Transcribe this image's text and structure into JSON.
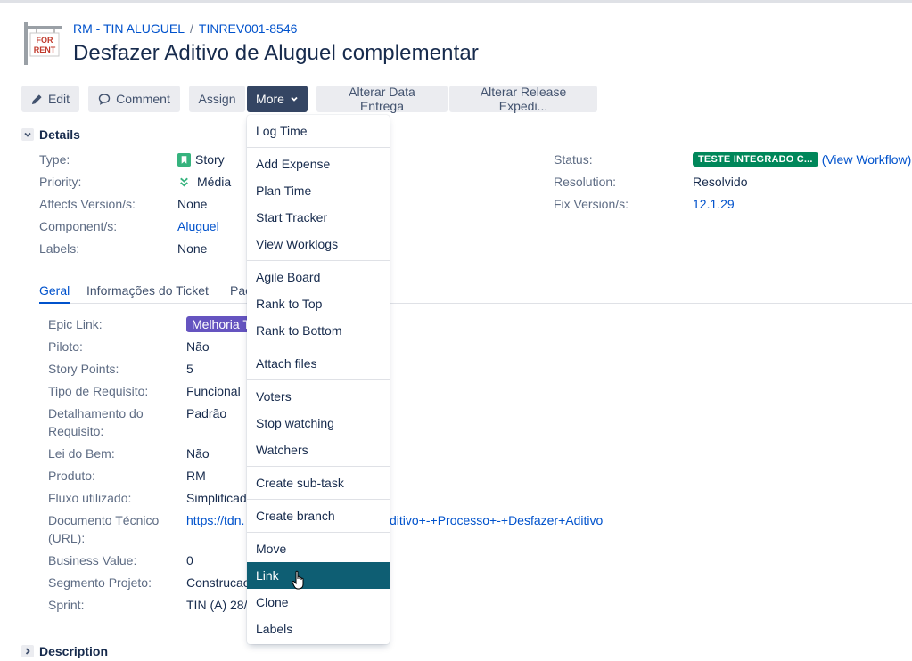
{
  "breadcrumb": {
    "project": "RM - TIN ALUGUEL",
    "separator": "/",
    "issue_key": "TINREV001-8546"
  },
  "title": "Desfazer Aditivo de Aluguel complementar",
  "project_avatar": {
    "icon": "for-rent-sign-icon",
    "text_line1": "FOR",
    "text_line2": "RENT"
  },
  "toolbar": {
    "edit": "Edit",
    "comment": "Comment",
    "assign": "Assign",
    "more": "More",
    "alterar_data": "Alterar Data Entrega",
    "alterar_release": "Alterar Release Expedi..."
  },
  "details": {
    "heading": "Details",
    "left": [
      {
        "label": "Type:",
        "value": "Story",
        "icon": "story-icon"
      },
      {
        "label": "Priority:",
        "value": "Média",
        "icon": "priority-medium-icon"
      },
      {
        "label": "Affects Version/s:",
        "value": "None"
      },
      {
        "label": "Component/s:",
        "value": "Aluguel"
      },
      {
        "label": "Labels:",
        "value": "None"
      }
    ],
    "right": {
      "status_label": "Status:",
      "status_value": "TESTE INTEGRADO C...",
      "view_workflow": "(View Workflow)",
      "resolution_label": "Resolution:",
      "resolution_value": "Resolvido",
      "fix_label": "Fix Version/s:",
      "fix_value": "12.1.29"
    }
  },
  "tabs": {
    "geral": "Geral",
    "informacoes": "Informações do Ticket",
    "pac": "Pac"
  },
  "geral_fields": [
    {
      "label": "Epic Link:",
      "value": "Melhoria T"
    },
    {
      "label": "Piloto:",
      "value": "Não"
    },
    {
      "label": "Story Points:",
      "value": "5"
    },
    {
      "label": "Tipo de Requisito:",
      "value": "Funcional"
    },
    {
      "label_line1": "Detalhamento do",
      "label_line2": "Requisito:",
      "value": "Padrão"
    },
    {
      "label": "Lei do Bem:",
      "value": "Não"
    },
    {
      "label": "Produto:",
      "value": "RM"
    },
    {
      "label": "Fluxo utilizado:",
      "value": "Simplificad"
    },
    {
      "label_line1": "Documento Técnico",
      "label_line2": "(URL):",
      "value_left": "https://tdn.",
      "value_right": "ditivo+-+Processo+-+Desfazer+Aditivo"
    },
    {
      "label": "Business Value:",
      "value": "0"
    },
    {
      "label": "Segmento Projeto:",
      "value": "Construcao"
    },
    {
      "label": "Sprint:",
      "value": "TIN (A) 28/"
    }
  ],
  "description": {
    "heading": "Description"
  },
  "more_menu": {
    "items": [
      "Log Time",
      "Add Expense",
      "Plan Time",
      "Start Tracker",
      "View Worklogs",
      "Agile Board",
      "Rank to Top",
      "Rank to Bottom",
      "Attach files",
      "Voters",
      "Stop watching",
      "Watchers",
      "Create sub-task",
      "Create branch",
      "Move",
      "Link",
      "Clone",
      "Labels"
    ],
    "hovered": "Link"
  },
  "colors": {
    "accent": "#0052cc",
    "status_green": "#00875a",
    "epic_purple": "#6554c0",
    "menu_hover": "#0e5e73",
    "more_active": "#344563"
  }
}
